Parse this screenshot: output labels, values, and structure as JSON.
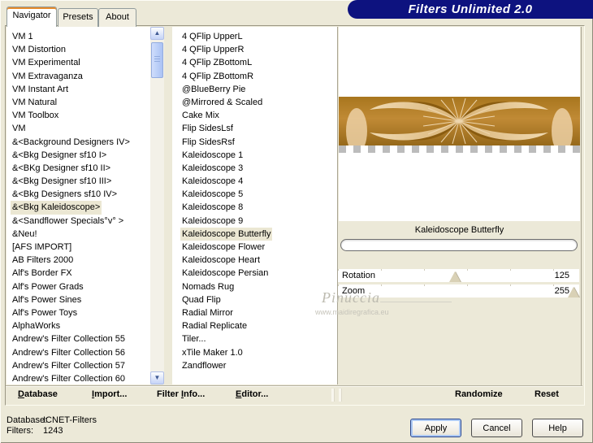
{
  "window": {
    "title": "Filters Unlimited 2.0"
  },
  "tabs": [
    {
      "label": "Navigator",
      "active": true
    },
    {
      "label": "Presets",
      "active": false
    },
    {
      "label": "About",
      "active": false
    }
  ],
  "left_list": {
    "selected_index": 13,
    "items": [
      "VM 1",
      "VM Distortion",
      "VM Experimental",
      "VM Extravaganza",
      "VM Instant Art",
      "VM Natural",
      "VM Toolbox",
      "VM",
      "&<Background Designers IV>",
      "&<Bkg Designer sf10 I>",
      "&<BKg Designer sf10 II>",
      "&<Bkg Designer sf10 III>",
      "&<Bkg Designers sf10 IV>",
      "&<Bkg Kaleidoscope>",
      "&<Sandflower Specials°v° >",
      "&Neu!",
      "[AFS IMPORT]",
      "AB Filters 2000",
      "Alf's Border FX",
      "Alf's Power Grads",
      "Alf's Power Sines",
      "Alf's Power Toys",
      "AlphaWorks",
      "Andrew's Filter Collection 55",
      "Andrew's Filter Collection 56",
      "Andrew's Filter Collection 57",
      "Andrew's Filter Collection 60"
    ]
  },
  "filter_list": {
    "selected_index": 15,
    "items": [
      "4 QFlip UpperL",
      "4 QFlip UpperR",
      "4 QFlip ZBottomL",
      "4 QFlip ZBottomR",
      "@BlueBerry Pie",
      "@Mirrored & Scaled",
      "Cake Mix",
      "Flip SidesLsf",
      "Flip SidesRsf",
      "Kaleidoscope 1",
      "Kaleidoscope 3",
      "Kaleidoscope 4",
      "Kaleidoscope 5",
      "Kaleidoscope 8",
      "Kaleidoscope 9",
      "Kaleidoscope Butterfly",
      "Kaleidoscope Flower",
      "Kaleidoscope Heart",
      "Kaleidoscope Persian",
      "Nomads Rug",
      "Quad Flip",
      "Radial Mirror",
      "Radial Replicate",
      "Tiler...",
      "xTile Maker 1.0",
      "Zandflower"
    ]
  },
  "preview": {
    "filter_name": "Kaleidoscope Butterfly"
  },
  "controls": {
    "rows": [
      {
        "label": "Rotation",
        "value": "125",
        "thumb_pct": 48.5
      },
      {
        "label": "Zoom",
        "value": "255",
        "thumb_pct": 97.5
      }
    ]
  },
  "toolbar": {
    "items": [
      {
        "pre": "",
        "accel": "D",
        "rest": "atabase"
      },
      {
        "pre": "",
        "accel": "I",
        "rest": "mport..."
      },
      {
        "pre": "Filter ",
        "accel": "I",
        "rest": "nfo..."
      },
      {
        "pre": "",
        "accel": "E",
        "rest": "ditor..."
      }
    ],
    "right_items": [
      {
        "label": "Randomize"
      },
      {
        "label": "Reset"
      }
    ]
  },
  "status": {
    "database_label": "Database:",
    "database_value": "ICNET-Filters",
    "filters_label": "Filters:",
    "filters_value": "1243"
  },
  "buttons": [
    {
      "label": "Apply",
      "default": true
    },
    {
      "label": "Cancel",
      "default": false
    },
    {
      "label": "Help",
      "default": false
    }
  ],
  "watermark": {
    "name": "Pinuccia",
    "url": "www.maidiregrafica.eu"
  },
  "icons": {
    "scroll_up": "▲",
    "scroll_down": "▼"
  },
  "colors": {
    "banner_navy": "#0d127f",
    "window_beige": "#ece9d8",
    "selection_highlight": "#ebe7d3",
    "tab_accent_orange": "#e68b2c",
    "preview_gold": "#b07b24",
    "preview_cream": "#ecd0a4"
  }
}
